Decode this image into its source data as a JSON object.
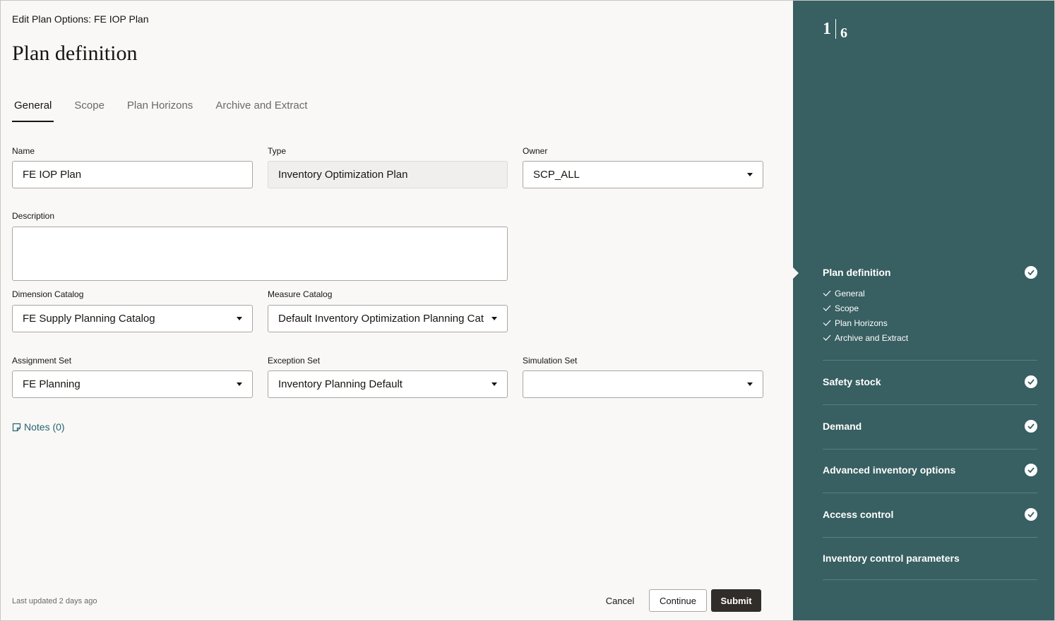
{
  "header": {
    "heading": "Edit Plan Options: FE IOP Plan",
    "title": "Plan definition"
  },
  "tabs": [
    {
      "label": "General",
      "active": true
    },
    {
      "label": "Scope",
      "active": false
    },
    {
      "label": "Plan Horizons",
      "active": false
    },
    {
      "label": "Archive and Extract",
      "active": false
    }
  ],
  "form": {
    "name": {
      "label": "Name",
      "value": "FE IOP Plan"
    },
    "type": {
      "label": "Type",
      "value": "Inventory Optimization Plan"
    },
    "owner": {
      "label": "Owner",
      "value": "SCP_ALL"
    },
    "description": {
      "label": "Description",
      "value": ""
    },
    "dimension_catalog": {
      "label": "Dimension Catalog",
      "value": "FE Supply Planning Catalog"
    },
    "measure_catalog": {
      "label": "Measure Catalog",
      "value": "Default Inventory Optimization Planning Cat"
    },
    "assignment_set": {
      "label": "Assignment Set",
      "value": "FE Planning"
    },
    "exception_set": {
      "label": "Exception Set",
      "value": "Inventory Planning Default"
    },
    "simulation_set": {
      "label": "Simulation Set",
      "value": ""
    }
  },
  "notes": {
    "label": "Notes (0)"
  },
  "footer": {
    "last_updated": "Last updated 2 days ago",
    "cancel": "Cancel",
    "continue": "Continue",
    "submit": "Submit"
  },
  "train": {
    "current": "1",
    "total": "6",
    "steps": [
      {
        "label": "Plan definition",
        "complete": true,
        "substeps": [
          "General",
          "Scope",
          "Plan Horizons",
          "Archive and Extract"
        ]
      },
      {
        "label": "Safety stock",
        "complete": true
      },
      {
        "label": "Demand",
        "complete": true
      },
      {
        "label": "Advanced inventory options",
        "complete": true
      },
      {
        "label": "Access control",
        "complete": true
      },
      {
        "label": "Inventory control parameters",
        "complete": false
      }
    ]
  },
  "colors": {
    "sidebar": "#385f61",
    "primary_button": "#312d2a",
    "link": "#26646e"
  }
}
